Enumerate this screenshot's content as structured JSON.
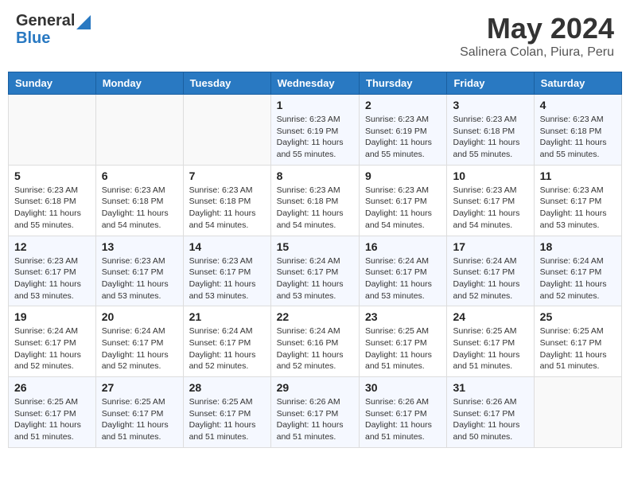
{
  "header": {
    "logo_line1": "General",
    "logo_line2": "Blue",
    "month": "May 2024",
    "location": "Salinera Colan, Piura, Peru"
  },
  "weekdays": [
    "Sunday",
    "Monday",
    "Tuesday",
    "Wednesday",
    "Thursday",
    "Friday",
    "Saturday"
  ],
  "weeks": [
    [
      {
        "day": "",
        "info": ""
      },
      {
        "day": "",
        "info": ""
      },
      {
        "day": "",
        "info": ""
      },
      {
        "day": "1",
        "info": "Sunrise: 6:23 AM\nSunset: 6:19 PM\nDaylight: 11 hours and 55 minutes."
      },
      {
        "day": "2",
        "info": "Sunrise: 6:23 AM\nSunset: 6:19 PM\nDaylight: 11 hours and 55 minutes."
      },
      {
        "day": "3",
        "info": "Sunrise: 6:23 AM\nSunset: 6:18 PM\nDaylight: 11 hours and 55 minutes."
      },
      {
        "day": "4",
        "info": "Sunrise: 6:23 AM\nSunset: 6:18 PM\nDaylight: 11 hours and 55 minutes."
      }
    ],
    [
      {
        "day": "5",
        "info": "Sunrise: 6:23 AM\nSunset: 6:18 PM\nDaylight: 11 hours and 55 minutes."
      },
      {
        "day": "6",
        "info": "Sunrise: 6:23 AM\nSunset: 6:18 PM\nDaylight: 11 hours and 54 minutes."
      },
      {
        "day": "7",
        "info": "Sunrise: 6:23 AM\nSunset: 6:18 PM\nDaylight: 11 hours and 54 minutes."
      },
      {
        "day": "8",
        "info": "Sunrise: 6:23 AM\nSunset: 6:18 PM\nDaylight: 11 hours and 54 minutes."
      },
      {
        "day": "9",
        "info": "Sunrise: 6:23 AM\nSunset: 6:17 PM\nDaylight: 11 hours and 54 minutes."
      },
      {
        "day": "10",
        "info": "Sunrise: 6:23 AM\nSunset: 6:17 PM\nDaylight: 11 hours and 54 minutes."
      },
      {
        "day": "11",
        "info": "Sunrise: 6:23 AM\nSunset: 6:17 PM\nDaylight: 11 hours and 53 minutes."
      }
    ],
    [
      {
        "day": "12",
        "info": "Sunrise: 6:23 AM\nSunset: 6:17 PM\nDaylight: 11 hours and 53 minutes."
      },
      {
        "day": "13",
        "info": "Sunrise: 6:23 AM\nSunset: 6:17 PM\nDaylight: 11 hours and 53 minutes."
      },
      {
        "day": "14",
        "info": "Sunrise: 6:23 AM\nSunset: 6:17 PM\nDaylight: 11 hours and 53 minutes."
      },
      {
        "day": "15",
        "info": "Sunrise: 6:24 AM\nSunset: 6:17 PM\nDaylight: 11 hours and 53 minutes."
      },
      {
        "day": "16",
        "info": "Sunrise: 6:24 AM\nSunset: 6:17 PM\nDaylight: 11 hours and 53 minutes."
      },
      {
        "day": "17",
        "info": "Sunrise: 6:24 AM\nSunset: 6:17 PM\nDaylight: 11 hours and 52 minutes."
      },
      {
        "day": "18",
        "info": "Sunrise: 6:24 AM\nSunset: 6:17 PM\nDaylight: 11 hours and 52 minutes."
      }
    ],
    [
      {
        "day": "19",
        "info": "Sunrise: 6:24 AM\nSunset: 6:17 PM\nDaylight: 11 hours and 52 minutes."
      },
      {
        "day": "20",
        "info": "Sunrise: 6:24 AM\nSunset: 6:17 PM\nDaylight: 11 hours and 52 minutes."
      },
      {
        "day": "21",
        "info": "Sunrise: 6:24 AM\nSunset: 6:17 PM\nDaylight: 11 hours and 52 minutes."
      },
      {
        "day": "22",
        "info": "Sunrise: 6:24 AM\nSunset: 6:16 PM\nDaylight: 11 hours and 52 minutes."
      },
      {
        "day": "23",
        "info": "Sunrise: 6:25 AM\nSunset: 6:17 PM\nDaylight: 11 hours and 51 minutes."
      },
      {
        "day": "24",
        "info": "Sunrise: 6:25 AM\nSunset: 6:17 PM\nDaylight: 11 hours and 51 minutes."
      },
      {
        "day": "25",
        "info": "Sunrise: 6:25 AM\nSunset: 6:17 PM\nDaylight: 11 hours and 51 minutes."
      }
    ],
    [
      {
        "day": "26",
        "info": "Sunrise: 6:25 AM\nSunset: 6:17 PM\nDaylight: 11 hours and 51 minutes."
      },
      {
        "day": "27",
        "info": "Sunrise: 6:25 AM\nSunset: 6:17 PM\nDaylight: 11 hours and 51 minutes."
      },
      {
        "day": "28",
        "info": "Sunrise: 6:25 AM\nSunset: 6:17 PM\nDaylight: 11 hours and 51 minutes."
      },
      {
        "day": "29",
        "info": "Sunrise: 6:26 AM\nSunset: 6:17 PM\nDaylight: 11 hours and 51 minutes."
      },
      {
        "day": "30",
        "info": "Sunrise: 6:26 AM\nSunset: 6:17 PM\nDaylight: 11 hours and 51 minutes."
      },
      {
        "day": "31",
        "info": "Sunrise: 6:26 AM\nSunset: 6:17 PM\nDaylight: 11 hours and 50 minutes."
      },
      {
        "day": "",
        "info": ""
      }
    ]
  ]
}
